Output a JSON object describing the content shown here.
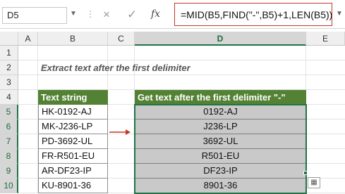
{
  "formula_bar": {
    "name_box": "D5",
    "dots": "⋮",
    "cancel_icon": "×",
    "enter_icon": "✓",
    "fx_label": "fx",
    "formula": "=MID(B5,FIND(\"-\",B5)+1,LEN(B5))"
  },
  "grid": {
    "columns": [
      "A",
      "B",
      "C",
      "D",
      "E"
    ],
    "rows": [
      "1",
      "2",
      "3",
      "4",
      "5",
      "6",
      "7",
      "8",
      "9",
      "10"
    ],
    "selected_column": "D",
    "title": "Extract text after the first delimiter",
    "header_b": "Text string",
    "header_d": "Get text after the first delimiter \"-\"",
    "text_strings": [
      "HK-0192-AJ",
      "MK-J236-LP",
      "PD-3692-UL",
      "FR-R501-EU",
      "AR-DF23-IP",
      "KU-8901-36"
    ],
    "results": [
      "0192-AJ",
      "J236-LP",
      "3692-UL",
      "R501-EU",
      "DF23-IP",
      "8901-36"
    ],
    "arrow_color": "#c0392b",
    "header_color": "#548235",
    "result_fill": "#c9c9c9"
  }
}
